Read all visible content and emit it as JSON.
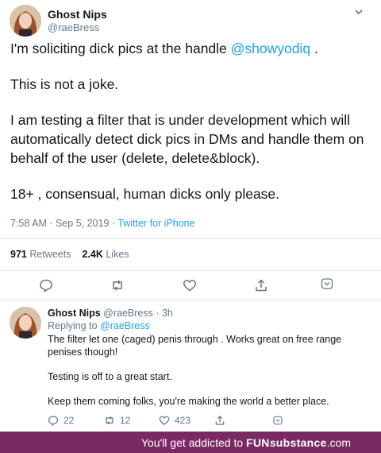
{
  "tweet": {
    "name": "Ghost Nips",
    "handle": "@raeBress",
    "line1_before": "I'm soliciting dick pics at the handle ",
    "line1_mention": "@showyodiq",
    "line1_after": " .",
    "para2": "This is not a joke.",
    "para3": "I am testing a filter that is under development which will automatically detect dick pics in DMs and handle them on behalf of the user (delete, delete&block).",
    "para4": "18+ , consensual, human dicks only please.",
    "timestamp": "7:58 AM · Sep 5, 2019 · ",
    "source": "Twitter for iPhone",
    "retweets_count": "971",
    "retweets_label": "Retweets",
    "likes_count": "2.4K",
    "likes_label": "Likes"
  },
  "reply": {
    "name": "Ghost Nips",
    "meta": "@raeBress · 3h",
    "replying_label": "Replying to ",
    "replying_mention": "@raeBress",
    "para1": "The filter let one (caged) penis through . Works great on free range penises though!",
    "para2": "Testing is off to a great start.",
    "para3": "Keep them coming folks, you're making the world a better place.",
    "reply_count": "22",
    "retweet_count": "12",
    "like_count": "423"
  },
  "footer": {
    "prefix": "You'll get addicted to ",
    "brand": "FUNsubstance",
    "suffix": ".com"
  },
  "colors": {
    "link": "#1da1f2",
    "muted": "#657786",
    "footer_bg": "#7a2a63"
  },
  "icons": [
    "chevron-down-icon",
    "reply-icon",
    "retweet-icon",
    "like-icon",
    "share-icon",
    "bookmark-icon"
  ]
}
